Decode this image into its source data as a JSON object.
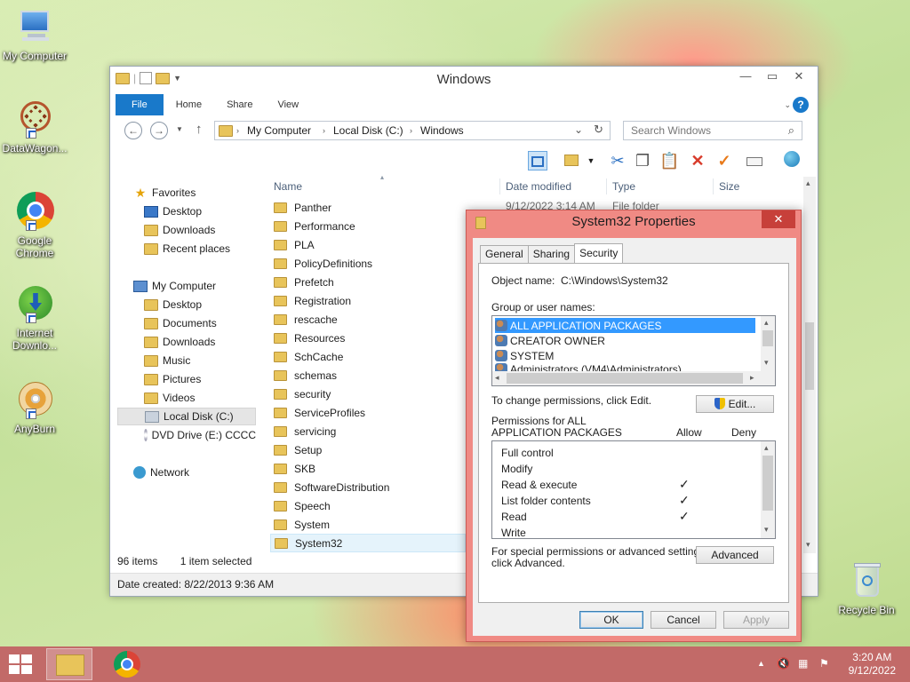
{
  "desktop": {
    "icons": [
      {
        "label": "My Computer"
      },
      {
        "label": "DataWagon..."
      },
      {
        "label": "Google Chrome"
      },
      {
        "label": "Internet Downlo..."
      },
      {
        "label": "AnyBurn"
      },
      {
        "label": "Recycle Bin"
      }
    ]
  },
  "explorer": {
    "title": "Windows",
    "ribbon_tabs": [
      "File",
      "Home",
      "Share",
      "View"
    ],
    "breadcrumb": [
      "My Computer",
      "Local Disk (C:)",
      "Windows"
    ],
    "search_placeholder": "Search Windows",
    "nav": {
      "favorites": "Favorites",
      "fav_items": [
        "Desktop",
        "Downloads",
        "Recent places"
      ],
      "computer": "My Computer",
      "pc_items": [
        "Desktop",
        "Documents",
        "Downloads",
        "Music",
        "Pictures",
        "Videos",
        "Local Disk (C:)",
        "DVD Drive (E:) CCCC"
      ],
      "network": "Network"
    },
    "columns": [
      "Name",
      "Date modified",
      "Type",
      "Size"
    ],
    "first_row_date": "9/12/2022 3:14 AM",
    "first_row_type": "File folder",
    "files": [
      "Panther",
      "Performance",
      "PLA",
      "PolicyDefinitions",
      "Prefetch",
      "Registration",
      "rescache",
      "Resources",
      "SchCache",
      "schemas",
      "security",
      "ServiceProfiles",
      "servicing",
      "Setup",
      "SKB",
      "SoftwareDistribution",
      "Speech",
      "System",
      "System32"
    ],
    "selected_file": "System32",
    "item_count": "96 items",
    "selection": "1 item selected",
    "details": "Date created: 8/22/2013 9:36 AM"
  },
  "props": {
    "title": "System32 Properties",
    "tabs": [
      "General",
      "Sharing",
      "Security"
    ],
    "object_label": "Object name:",
    "object_value": "C:\\Windows\\System32",
    "group_label": "Group or user names:",
    "groups": [
      "ALL APPLICATION PACKAGES",
      "CREATOR OWNER",
      "SYSTEM",
      "Administrators (VM4\\Administrators)"
    ],
    "change_text": "To change permissions, click Edit.",
    "edit_btn": "Edit...",
    "perm_label_1": "Permissions for ALL",
    "perm_label_2": "APPLICATION PACKAGES",
    "allow": "Allow",
    "deny": "Deny",
    "permissions": [
      {
        "name": "Full control",
        "allow": ""
      },
      {
        "name": "Modify",
        "allow": ""
      },
      {
        "name": "Read & execute",
        "allow": "✓"
      },
      {
        "name": "List folder contents",
        "allow": "✓"
      },
      {
        "name": "Read",
        "allow": "✓"
      },
      {
        "name": "Write",
        "allow": ""
      }
    ],
    "special_1": "For special permissions or advanced settings,",
    "special_2": "click Advanced.",
    "advanced_btn": "Advanced",
    "ok_btn": "OK",
    "cancel_btn": "Cancel",
    "apply_btn": "Apply"
  },
  "taskbar": {
    "time": "3:20 AM",
    "date": "9/12/2022"
  }
}
